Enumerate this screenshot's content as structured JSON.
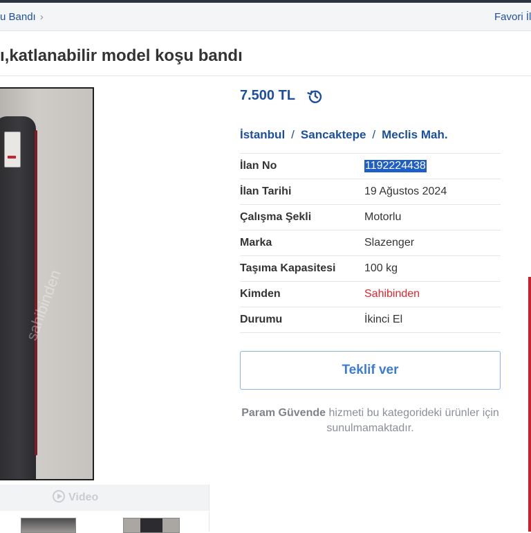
{
  "breadcrumb": {
    "last_label": "u Bandı",
    "chevron": "›"
  },
  "header": {
    "favorite_label": "Favori İl"
  },
  "listing": {
    "title": "ı,katlanabilir model koşu bandı",
    "price": "7.500 TL",
    "history_icon": "price-history-icon",
    "location": {
      "city": "İstanbul",
      "district": "Sancaktepe",
      "neighborhood": "Meclis Mah.",
      "separator": "/"
    },
    "details": [
      {
        "label": "İlan No",
        "value": "1192224438"
      },
      {
        "label": "İlan Tarihi",
        "value": "19 Ağustos 2024"
      },
      {
        "label": "Çalışma Şekli",
        "value": "Motorlu"
      },
      {
        "label": "Marka",
        "value": "Slazenger"
      },
      {
        "label": "Taşıma Kapasitesi",
        "value": "100 kg"
      },
      {
        "label": "Kimden",
        "value": "Sahibinden"
      },
      {
        "label": "Durumu",
        "value": "İkinci El"
      }
    ],
    "offer_button": "Teklif ver",
    "safe_note": {
      "bold": "Param Güvende",
      "rest": " hizmeti bu kategorideki ürünler için sunulmamaktadır."
    }
  },
  "gallery": {
    "video_label": "Video",
    "watermark": "sahibinden"
  },
  "colors": {
    "link_blue": "#1d4e9e",
    "seller_red": "#e0262f",
    "button_blue": "#3c7bd4",
    "selection_blue": "#1d5ec9"
  }
}
